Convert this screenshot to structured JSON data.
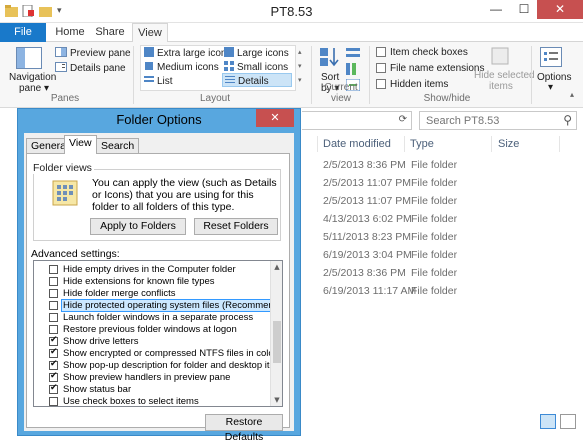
{
  "window": {
    "title": "PT8.53",
    "minimize": "—",
    "maximize": "☐",
    "close": "✕"
  },
  "ribbon_tabs": [
    "File",
    "Home",
    "Share",
    "View"
  ],
  "ribbon": {
    "panes": {
      "navigation_pane": "Navigation",
      "navigation_pane_sub": "pane ▾",
      "preview_pane": "Preview pane",
      "details_pane": "Details pane",
      "label": "Panes"
    },
    "layout": {
      "extra_large": "Extra large icons",
      "large": "Large icons",
      "medium": "Medium icons",
      "small": "Small icons",
      "list": "List",
      "details": "Details",
      "label": "Layout"
    },
    "current_view": {
      "sort_by": "Sort",
      "sort_by_sub": "by ▾",
      "label": "Current view"
    },
    "show_hide": {
      "item_check_boxes": "Item check boxes",
      "file_name_extensions": "File name extensions",
      "hidden_items": "Hidden items",
      "hide_selected_1": "Hide selected",
      "hide_selected_2": "items",
      "label": "Show/hide"
    },
    "options": {
      "label": "Options",
      "sub": "▾"
    }
  },
  "search": {
    "placeholder": "Search PT8.53"
  },
  "columns": {
    "date_modified": "Date modified",
    "type": "Type",
    "size": "Size"
  },
  "files": [
    {
      "date": "2/5/2013 8:36 PM",
      "type": "File folder"
    },
    {
      "date": "2/5/2013 11:07 PM",
      "type": "File folder"
    },
    {
      "date": "2/5/2013 11:07 PM",
      "type": "File folder"
    },
    {
      "date": "4/13/2013 6:02 PM",
      "type": "File folder"
    },
    {
      "date": "5/11/2013 8:23 PM",
      "type": "File folder"
    },
    {
      "date": "6/19/2013 3:04 PM",
      "type": "File folder"
    },
    {
      "date": "2/5/2013 8:36 PM",
      "type": "File folder"
    },
    {
      "date": "6/19/2013 11:17 AM",
      "type": "File folder"
    }
  ],
  "dialog": {
    "title": "Folder Options",
    "close": "✕",
    "tabs": [
      "General",
      "View",
      "Search"
    ],
    "folder_views": {
      "label": "Folder views",
      "text": "You can apply the view (such as Details or Icons) that you are using for this folder to all folders of this type.",
      "apply": "Apply to Folders",
      "reset": "Reset Folders"
    },
    "advanced_label": "Advanced settings:",
    "advanced": [
      {
        "label": "Hide empty drives in the Computer folder",
        "checked": false
      },
      {
        "label": "Hide extensions for known file types",
        "checked": false
      },
      {
        "label": "Hide folder merge conflicts",
        "checked": false
      },
      {
        "label": "Hide protected operating system files (Recommended)",
        "checked": false,
        "highlighted": true
      },
      {
        "label": "Launch folder windows in a separate process",
        "checked": false
      },
      {
        "label": "Restore previous folder windows at logon",
        "checked": false
      },
      {
        "label": "Show drive letters",
        "checked": true
      },
      {
        "label": "Show encrypted or compressed NTFS files in color",
        "checked": true
      },
      {
        "label": "Show pop-up description for folder and desktop items",
        "checked": true
      },
      {
        "label": "Show preview handlers in preview pane",
        "checked": true
      },
      {
        "label": "Show status bar",
        "checked": true
      },
      {
        "label": "Use check boxes to select items",
        "checked": false
      }
    ],
    "restore_defaults": "Restore Defaults"
  },
  "colors": {
    "accent": "#1979ca",
    "dialog_frame": "#58a7df",
    "close_red": "#c75050"
  }
}
